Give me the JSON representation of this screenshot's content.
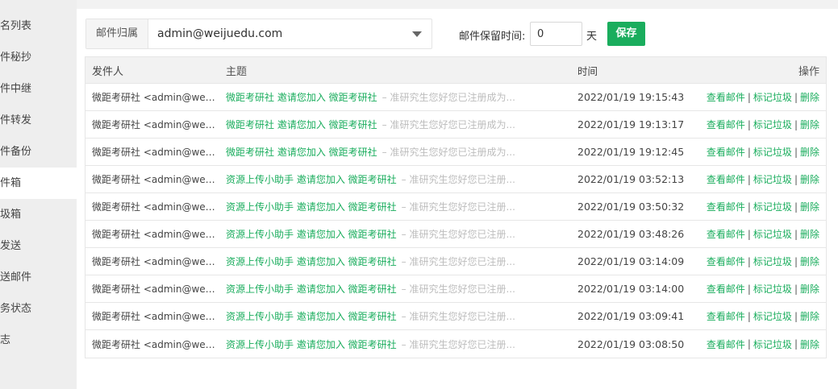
{
  "sidebar": {
    "items": [
      {
        "label": "名列表"
      },
      {
        "label": "件秘抄"
      },
      {
        "label": "件中继"
      },
      {
        "label": "件转发"
      },
      {
        "label": "件备份"
      },
      {
        "label": "件箱",
        "active": true
      },
      {
        "label": "圾箱"
      },
      {
        "label": "发送"
      },
      {
        "label": "送邮件"
      },
      {
        "label": "务状态"
      },
      {
        "label": "志"
      }
    ]
  },
  "filter": {
    "owner_label": "邮件归属",
    "owner_value": "admin@weijuedu.com",
    "retention_label": "邮件保留时间:",
    "retention_value": "0",
    "retention_unit": "天",
    "save_label": "保存"
  },
  "table": {
    "headers": {
      "sender": "发件人",
      "subject": "主题",
      "time": "时间",
      "actions": "操作"
    },
    "actions": {
      "view": "查看邮件",
      "separator": "|",
      "mark_spam": "标记垃圾",
      "delete": "删除"
    },
    "rows": [
      {
        "sender": "微距考研社 <admin@weij...",
        "subject": "微距考研社 邀请您加入 微距考研社",
        "preview": "– 准研究生您好您已注册成为...",
        "time": "2022/01/19 19:15:43"
      },
      {
        "sender": "微距考研社 <admin@weij...",
        "subject": "微距考研社 邀请您加入 微距考研社",
        "preview": "– 准研究生您好您已注册成为...",
        "time": "2022/01/19 19:13:17"
      },
      {
        "sender": "微距考研社 <admin@weij...",
        "subject": "微距考研社 邀请您加入 微距考研社",
        "preview": "– 准研究生您好您已注册成为...",
        "time": "2022/01/19 19:12:45"
      },
      {
        "sender": "微距考研社 <admin@weij...",
        "subject": "资源上传小助手 邀请您加入 微距考研社",
        "preview": "– 准研究生您好您已注册...",
        "time": "2022/01/19 03:52:13"
      },
      {
        "sender": "微距考研社 <admin@weij...",
        "subject": "资源上传小助手 邀请您加入 微距考研社",
        "preview": "– 准研究生您好您已注册...",
        "time": "2022/01/19 03:50:32"
      },
      {
        "sender": "微距考研社 <admin@weij...",
        "subject": "资源上传小助手 邀请您加入 微距考研社",
        "preview": "– 准研究生您好您已注册...",
        "time": "2022/01/19 03:48:26"
      },
      {
        "sender": "微距考研社 <admin@weij...",
        "subject": "资源上传小助手 邀请您加入 微距考研社",
        "preview": "– 准研究生您好您已注册...",
        "time": "2022/01/19 03:14:09"
      },
      {
        "sender": "微距考研社 <admin@weij...",
        "subject": "资源上传小助手 邀请您加入 微距考研社",
        "preview": "– 准研究生您好您已注册...",
        "time": "2022/01/19 03:14:00"
      },
      {
        "sender": "微距考研社 <admin@weij...",
        "subject": "资源上传小助手 邀请您加入 微距考研社",
        "preview": "– 准研究生您好您已注册...",
        "time": "2022/01/19 03:09:41"
      },
      {
        "sender": "微距考研社 <admin@weij...",
        "subject": "资源上传小助手 邀请您加入 微距考研社",
        "preview": "– 准研究生您好您已注册...",
        "time": "2022/01/19 03:08:50"
      }
    ]
  }
}
